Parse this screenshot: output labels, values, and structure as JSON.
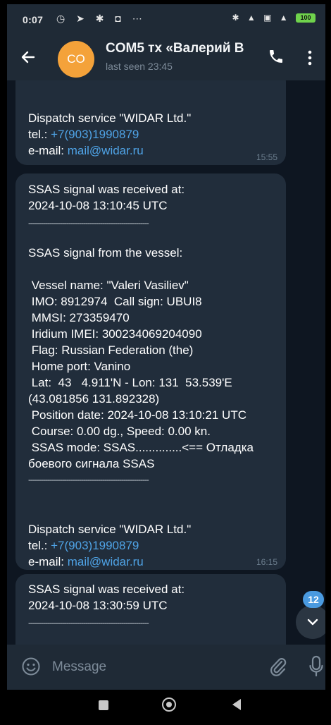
{
  "status_bar": {
    "time": "0:07",
    "left_icons": "◷ ➤ ✱ ◘ ⋯",
    "right_icons": "✱ ▲ ▣ ▲",
    "battery": "100"
  },
  "header": {
    "back_icon": "arrow-left-icon",
    "avatar_initials": "CO",
    "title": "COM5 тх «Валерий В",
    "status": "last seen 23:45",
    "accent": "#f4a23a"
  },
  "messages": [
    {
      "lines": [
        "",
        "",
        "Dispatch service \"WIDAR Ltd.\"",
        "tel.: +7(903)1990879",
        "e-mail: mail@widar.ru"
      ],
      "tel_label": "tel.: ",
      "tel": "+7(903)1990879",
      "email_label": "e-mail: ",
      "email": "mail@widar.ru",
      "time": "15:55"
    },
    {
      "header_lines": [
        "SSAS signal was received at:",
        "2024-10-08 13:10:45 UTC"
      ],
      "separator": "---------------------------------------------------------",
      "body_lines": [
        "SSAS signal from the vessel:",
        "",
        " Vessel name: \"Valeri Vasiliev\"",
        " IMO: 8912974  Call sign: UBUI8",
        " MMSI: 273359470",
        " Iridium IMEI: 300234069204090",
        " Flag: Russian Federation (the)",
        " Home port: Vanino",
        " Lat:  43   4.911'N - Lon: 131  53.539'E",
        "(43.081856 131.892328)",
        " Position date: 2024-10-08 13:10:21 UTC",
        " Course: 0.00 dg., Speed: 0.00 kn.",
        " SSAS mode: SSAS..............<== Отладка",
        "боевого сигнала SSAS"
      ],
      "footer_text": "Dispatch service \"WIDAR Ltd.\"",
      "tel_label": "tel.: ",
      "tel": "+7(903)1990879",
      "email_label": "e-mail: ",
      "email": "mail@widar.ru",
      "time": "16:15"
    },
    {
      "header_lines": [
        "SSAS signal was received at:",
        "2024-10-08 13:30:59 UTC"
      ],
      "separator": "---------------------------------------------------------"
    }
  ],
  "scroll_down": {
    "unread_count": "12",
    "icon": "chevron-down-icon"
  },
  "composer": {
    "placeholder": "Message",
    "emoji_icon": "emoji-icon",
    "attach_icon": "paperclip-icon",
    "mic_icon": "microphone-icon"
  },
  "colors": {
    "link": "#4fa3e6",
    "bubble": "#212d3b",
    "badge": "#4a9ae0"
  }
}
